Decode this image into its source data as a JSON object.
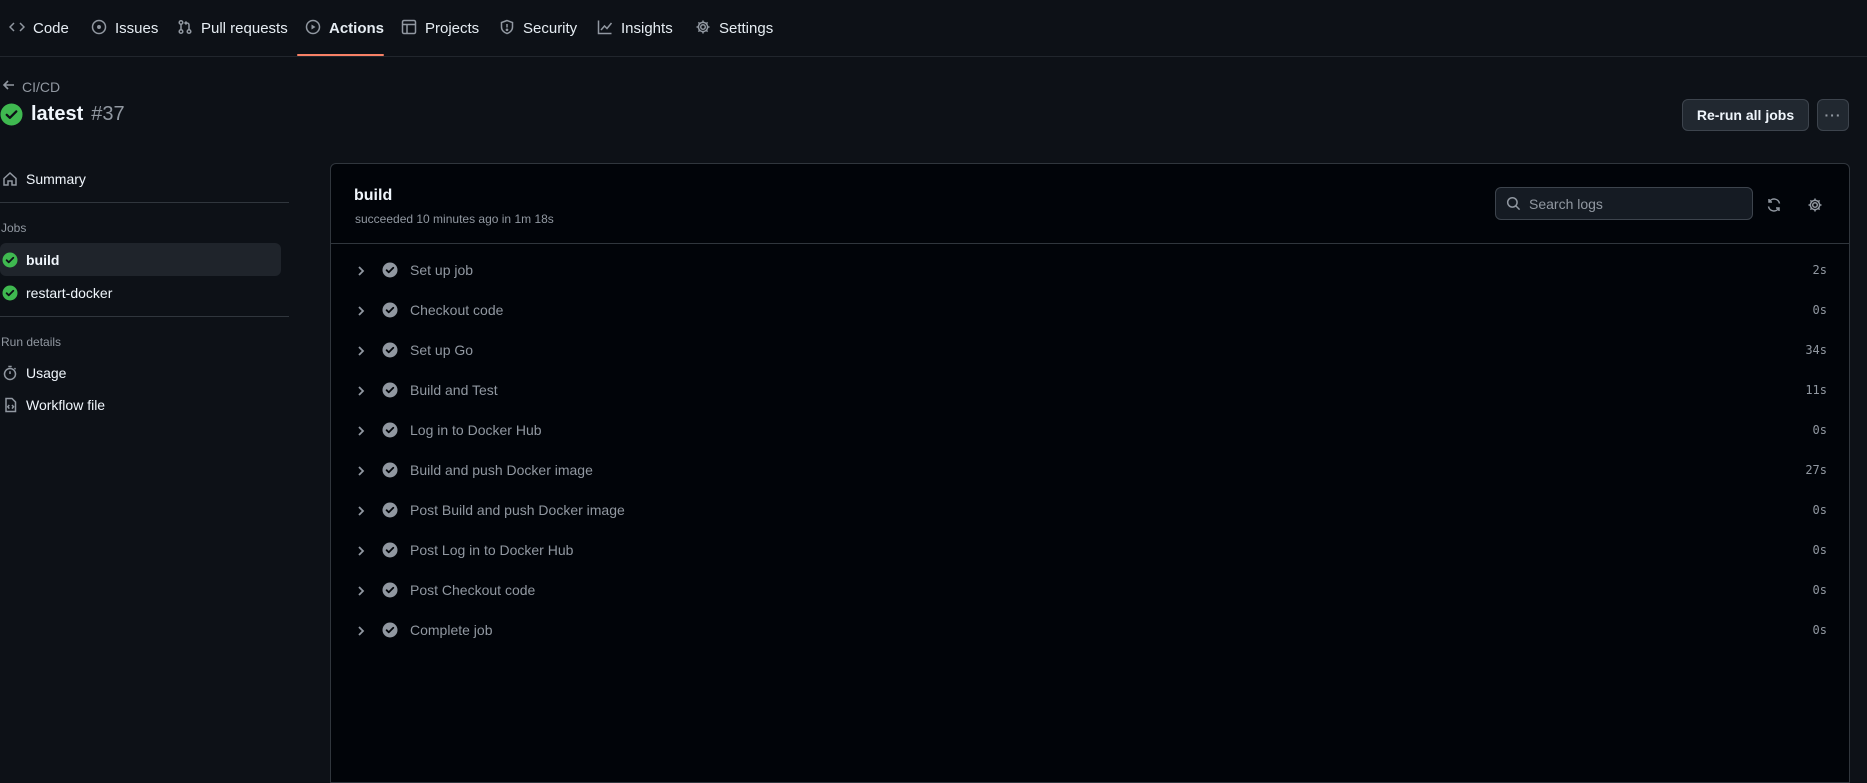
{
  "nav": {
    "tabs": [
      {
        "label": "Code",
        "icon": "code-icon"
      },
      {
        "label": "Issues",
        "icon": "issue-opened-icon"
      },
      {
        "label": "Pull requests",
        "icon": "git-pull-request-icon"
      },
      {
        "label": "Actions",
        "icon": "play-icon"
      },
      {
        "label": "Projects",
        "icon": "table-icon"
      },
      {
        "label": "Security",
        "icon": "shield-icon"
      },
      {
        "label": "Insights",
        "icon": "graph-icon"
      },
      {
        "label": "Settings",
        "icon": "gear-icon"
      }
    ],
    "active": "Actions"
  },
  "header": {
    "back_label": "CI/CD",
    "run_name": "latest",
    "run_number": "#37",
    "rerun_label": "Re-run all jobs",
    "more_label": "···"
  },
  "sidebar": {
    "summary_label": "Summary",
    "jobs_heading": "Jobs",
    "jobs": [
      {
        "label": "build",
        "status": "success",
        "selected": true
      },
      {
        "label": "restart-docker",
        "status": "success",
        "selected": false
      }
    ],
    "run_details_heading": "Run details",
    "usage_label": "Usage",
    "workflow_label": "Workflow file"
  },
  "job": {
    "title": "build",
    "subtitle": "succeeded 10 minutes ago in 1m 18s",
    "search_placeholder": "Search logs",
    "steps": [
      {
        "name": "Set up job",
        "duration": "2s"
      },
      {
        "name": "Checkout code",
        "duration": "0s"
      },
      {
        "name": "Set up Go",
        "duration": "34s"
      },
      {
        "name": "Build and Test",
        "duration": "11s"
      },
      {
        "name": "Log in to Docker Hub",
        "duration": "0s"
      },
      {
        "name": "Build and push Docker image",
        "duration": "27s"
      },
      {
        "name": "Post Build and push Docker image",
        "duration": "0s"
      },
      {
        "name": "Post Log in to Docker Hub",
        "duration": "0s"
      },
      {
        "name": "Post Checkout code",
        "duration": "0s"
      },
      {
        "name": "Complete job",
        "duration": "0s"
      }
    ]
  },
  "colors": {
    "success": "#3fb950",
    "step_check": "#9198a1",
    "accent_underline": "#f78166",
    "background": "#0d1117"
  }
}
